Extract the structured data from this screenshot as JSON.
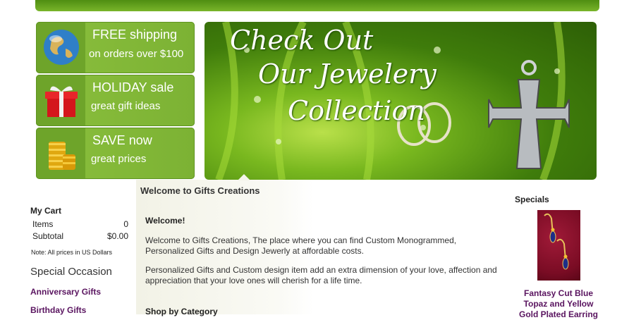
{
  "promos": [
    {
      "line1": "FREE shipping",
      "line2": "on orders over $100",
      "icon": "globe-icon"
    },
    {
      "line1": "HOLIDAY sale",
      "line2": "great gift ideas",
      "icon": "gift-icon"
    },
    {
      "line1": "SAVE now",
      "line2": "great prices",
      "icon": "coins-icon"
    }
  ],
  "banner": {
    "line1": "Check Out",
    "line2": "Our Jewelery",
    "line3": "Collection"
  },
  "welcome": {
    "title": "Welcome to Gifts Creations",
    "heading": "Welcome!",
    "para1": "Welcome to Gifts Creations, The place where you can find Custom Monogrammed, Personalized Gifts and Design Jewerly at affordable costs.",
    "para2": "Personalized Gifts and Custom design item add an extra dimension of your love, affection and appreciation that your love ones will cherish for a life time.",
    "shop_heading": "Shop by Category"
  },
  "cart": {
    "title": "My Cart",
    "items_label": "Items",
    "items_value": "0",
    "subtotal_label": "Subtotal",
    "subtotal_value": "$0.00",
    "note": "Note: All prices in US Dollars"
  },
  "occasion": {
    "title": "Special Occasion",
    "links": [
      "Anniversary Gifts",
      "Birthday Gifts"
    ]
  },
  "specials": {
    "title": "Specials",
    "product_name": "Fantasy Cut Blue Topaz and Yellow Gold Plated Earring"
  },
  "colors": {
    "accent": "#7cb234",
    "link": "#5a1560"
  }
}
